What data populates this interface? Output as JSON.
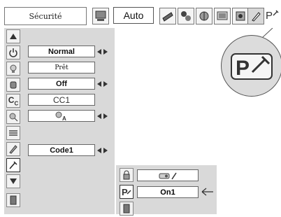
{
  "header": {
    "menu_title": "Sécurité",
    "input_source": "Auto",
    "pin_icon_label": "P"
  },
  "sidebar": {
    "items": [
      {
        "icon": "up-arrow-icon"
      },
      {
        "icon": "power-icon"
      },
      {
        "icon": "lamp-icon"
      },
      {
        "icon": "hand-icon"
      },
      {
        "icon": "closed-caption-icon"
      },
      {
        "icon": "lamp-eco-icon"
      },
      {
        "icon": "filter-icon"
      },
      {
        "icon": "pencil-icon"
      },
      {
        "icon": "security-key-icon"
      },
      {
        "icon": "down-arrow-icon"
      },
      {
        "icon": "exit-icon"
      }
    ]
  },
  "menu": {
    "row1": "Normal",
    "row2": "Prêt",
    "row3": "Off",
    "row4": "CC1",
    "row5_icon": "lamp-a-icon",
    "row9": "Code1"
  },
  "submenu": {
    "top_icon": "lock-icon",
    "top_value_icon": "projector-lock-icon",
    "selected_value": "On1",
    "selected_icon": "pin-key-icon",
    "exit_icon": "exit-icon"
  },
  "colors": {
    "panel_bg": "#d9d9d9",
    "field_bg": "#ffffff"
  }
}
